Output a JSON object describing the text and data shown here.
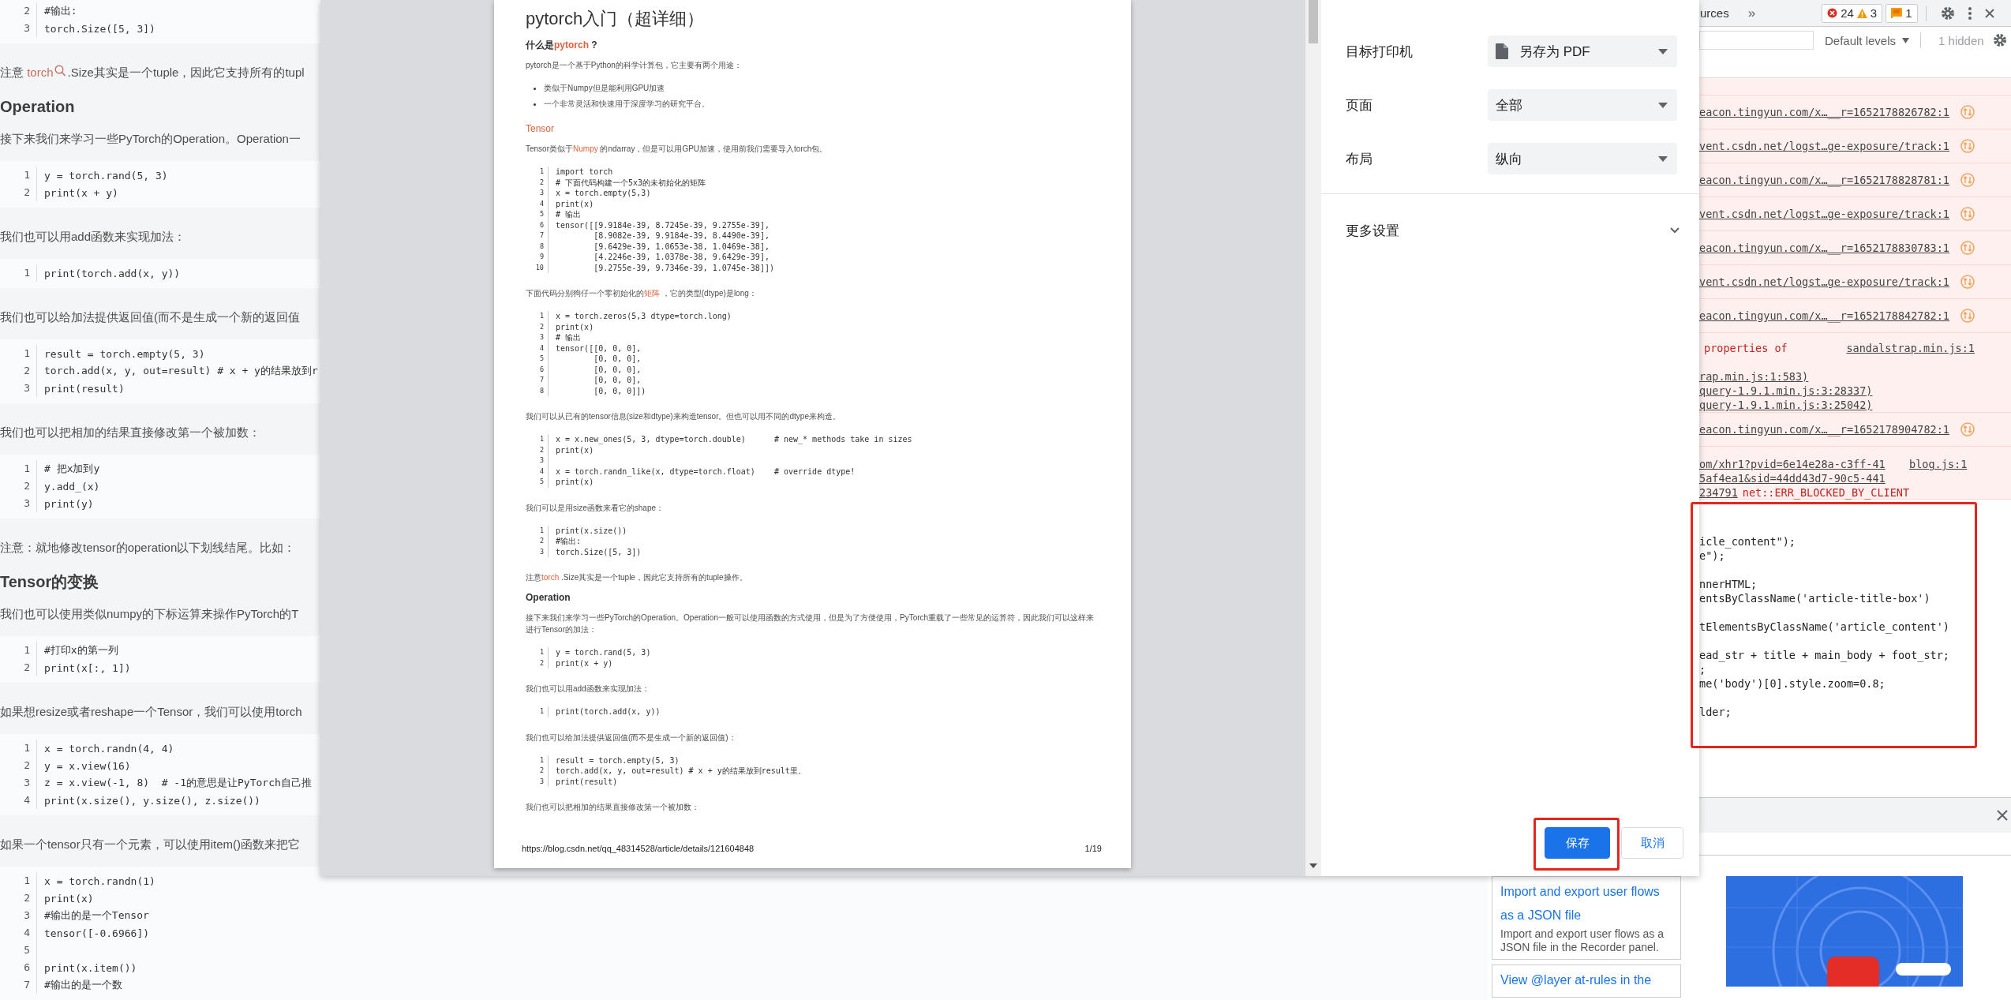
{
  "article": {
    "blocks": [
      {
        "kind": "code",
        "lines": [
          [
            "2",
            "#输出:"
          ],
          [
            "3",
            "torch.Size([5, 3])"
          ]
        ]
      },
      {
        "kind": "paragraph",
        "parts": [
          {
            "text": "注意 "
          },
          {
            "text": "torch",
            "kind": "search_link"
          },
          {
            "text": ".Size其实是一个tuple，因此它支持所有的tupl"
          }
        ]
      },
      {
        "kind": "heading",
        "parts": [
          {
            "text": "Operation"
          }
        ]
      },
      {
        "kind": "paragraph",
        "parts": [
          {
            "text": "接下来我们来学习一些PyTorch的Operation。Operation一"
          }
        ]
      },
      {
        "kind": "code",
        "lines": [
          [
            "1",
            "y = torch.rand(5, 3)"
          ],
          [
            "2",
            "print(x + y)"
          ]
        ]
      },
      {
        "kind": "paragraph",
        "parts": [
          {
            "text": "我们也可以用add函数来实现加法："
          }
        ]
      },
      {
        "kind": "code",
        "lines": [
          [
            "1",
            "print(torch.add(x, y))"
          ]
        ]
      },
      {
        "kind": "paragraph",
        "parts": [
          {
            "text": "我们也可以给加法提供返回值(而不是生成一个新的返回值"
          }
        ]
      },
      {
        "kind": "code",
        "lines": [
          [
            "1",
            "result = torch.empty(5, 3)"
          ],
          [
            "2",
            "torch.add(x, y, out=result) # x + y的结果放到r"
          ],
          [
            "3",
            "print(result)"
          ]
        ]
      },
      {
        "kind": "paragraph",
        "parts": [
          {
            "text": "我们也可以把相加的结果直接修改第一个被加数："
          }
        ]
      },
      {
        "kind": "code",
        "lines": [
          [
            "1",
            "# 把x加到y"
          ],
          [
            "2",
            "y.add_(x)"
          ],
          [
            "3",
            "print(y)"
          ]
        ]
      },
      {
        "kind": "paragraph",
        "parts": [
          {
            "text": "注意：就地修改tensor的operation以下划线结尾。比如："
          }
        ]
      },
      {
        "kind": "heading",
        "parts": [
          {
            "text": "Tensor的变换"
          }
        ]
      },
      {
        "kind": "paragraph",
        "parts": [
          {
            "text": "我们也可以使用类似numpy的下标运算来操作PyTorch的T"
          }
        ]
      },
      {
        "kind": "code",
        "lines": [
          [
            "1",
            "#打印x的第一列"
          ],
          [
            "2",
            "print(x[:, 1])"
          ]
        ]
      },
      {
        "kind": "paragraph",
        "parts": [
          {
            "text": "如果想resize或者reshape一个Tensor，我们可以使用torch"
          }
        ]
      },
      {
        "kind": "code",
        "lines": [
          [
            "1",
            "x = torch.randn(4, 4)"
          ],
          [
            "2",
            "y = x.view(16)"
          ],
          [
            "3",
            "z = x.view(-1, 8)  # -1的意思是让PyTorch自己推"
          ],
          [
            "4",
            "print(x.size(), y.size(), z.size())"
          ]
        ]
      },
      {
        "kind": "paragraph",
        "parts": [
          {
            "text": "如果一个tensor只有一个元素，可以使用item()函数来把它"
          }
        ]
      },
      {
        "kind": "code",
        "lines": [
          [
            "1",
            "x = torch.randn(1)"
          ],
          [
            "2",
            "print(x)"
          ],
          [
            "3",
            "#输出的是一个Tensor"
          ],
          [
            "4",
            "tensor([-0.6966])"
          ],
          [
            "5"
          ],
          [
            "6",
            "print(x.item())"
          ],
          [
            "7",
            "#输出的是一个数"
          ]
        ]
      }
    ]
  },
  "print_preview": {
    "blocks": [
      {
        "kind": "title",
        "parts": [
          {
            "text": "pytorch入门（超详细）"
          }
        ]
      },
      {
        "kind": "heading",
        "parts": [
          {
            "text": "什么是"
          },
          {
            "text": "pytorch",
            "kind": "link"
          },
          {
            "text": "  ?"
          }
        ]
      },
      {
        "kind": "paragraph",
        "parts": [
          {
            "text": "pytorch是一个基于Python的科学计算包，它主要有两个用途："
          }
        ]
      },
      {
        "kind": "list",
        "items": [
          "类似于Numpy但是能利用GPU加速",
          "一个非常灵活和快速用于深度学习的研究平台。"
        ]
      },
      {
        "kind": "section",
        "parts": [
          {
            "text": "Tensor",
            "kind": "link"
          }
        ]
      },
      {
        "kind": "paragraph",
        "parts": [
          {
            "text": "Tensor类似于"
          },
          {
            "text": "Numpy",
            "kind": "link"
          },
          {
            "text": "   的ndarray，但是可以用GPU加速，使用前我们需要导入torch包。"
          }
        ]
      },
      {
        "kind": "code",
        "lines": [
          [
            "1",
            "import torch"
          ],
          [
            "2",
            "# 下面代码构建一个5x3的未初始化的矩阵"
          ],
          [
            "3",
            "x = torch.empty(5,3)"
          ],
          [
            "4",
            "print(x)"
          ],
          [
            "5",
            "# 输出"
          ],
          [
            "6",
            "tensor([[9.9184e-39, 8.7245e-39, 9.2755e-39],"
          ],
          [
            "7",
            "        [8.9082e-39, 9.9184e-39, 8.4490e-39],"
          ],
          [
            "8",
            "        [9.6429e-39, 1.0653e-38, 1.0469e-38],"
          ],
          [
            "9",
            "        [4.2246e-39, 1.0378e-38, 9.6429e-39],"
          ],
          [
            "10",
            "        [9.2755e-39, 9.7346e-39, 1.0745e-38]])"
          ]
        ]
      },
      {
        "kind": "paragraph",
        "parts": [
          {
            "text": "下面代码分别狗仔一个零初始化的"
          },
          {
            "text": "矩阵",
            "kind": "link"
          },
          {
            "text": "   ，它的类型(dtype)是long："
          }
        ]
      },
      {
        "kind": "code",
        "lines": [
          [
            "1",
            "x = torch.zeros(5,3 dtype=torch.long)"
          ],
          [
            "2",
            "print(x)"
          ],
          [
            "3",
            "# 输出"
          ],
          [
            "4",
            "tensor([[0, 0, 0],"
          ],
          [
            "5",
            "        [0, 0, 0],"
          ],
          [
            "6",
            "        [0, 0, 0],"
          ],
          [
            "7",
            "        [0, 0, 0],"
          ],
          [
            "8",
            "        [0, 0, 0]])"
          ]
        ]
      },
      {
        "kind": "paragraph",
        "parts": [
          {
            "text": "我们可以从已有的tensor信息(size和dtype)来构造tensor。但也可以用不同的dtype来构造。"
          }
        ]
      },
      {
        "kind": "code",
        "lines": [
          [
            "1",
            "x = x.new_ones(5, 3, dtype=torch.double)      # new_* methods take in sizes"
          ],
          [
            "2",
            "print(x)"
          ],
          [
            "3"
          ],
          [
            "4",
            "x = torch.randn_like(x, dtype=torch.float)    # override dtype!"
          ],
          [
            "5",
            "print(x)"
          ]
        ]
      },
      {
        "kind": "paragraph",
        "parts": [
          {
            "text": "我们可以是用size函数来看它的shape："
          }
        ]
      },
      {
        "kind": "code",
        "lines": [
          [
            "1",
            "print(x.size())"
          ],
          [
            "2",
            "#输出:"
          ],
          [
            "3",
            "torch.Size([5, 3])"
          ]
        ]
      },
      {
        "kind": "paragraph",
        "parts": [
          {
            "text": "注意"
          },
          {
            "text": "torch",
            "kind": "link"
          },
          {
            "text": "    .Size其实是一个tuple，因此它支持所有的tuple操作。"
          }
        ]
      },
      {
        "kind": "heading",
        "parts": [
          {
            "text": "Operation"
          }
        ]
      },
      {
        "kind": "paragraph",
        "parts": [
          {
            "text": "接下来我们来学习一些PyTorch的Operation。Operation一般可以使用函数的方式使用，但是为了方便使用，PyTorch重载了一些常见的运算符，因此我们可以这样来进行Tensor的加法："
          }
        ]
      },
      {
        "kind": "code",
        "lines": [
          [
            "1",
            "y = torch.rand(5, 3)"
          ],
          [
            "2",
            "print(x + y)"
          ]
        ]
      },
      {
        "kind": "paragraph",
        "parts": [
          {
            "text": "我们也可以用add函数来实现加法："
          }
        ]
      },
      {
        "kind": "code",
        "lines": [
          [
            "1",
            "print(torch.add(x, y))"
          ]
        ]
      },
      {
        "kind": "paragraph",
        "parts": [
          {
            "text": "我们也可以给加法提供返回值(而不是生成一个新的返回值)："
          }
        ]
      },
      {
        "kind": "code",
        "lines": [
          [
            "1",
            "result = torch.empty(5, 3)"
          ],
          [
            "2",
            "torch.add(x, y, out=result) # x + y的结果放到result里。"
          ],
          [
            "3",
            "print(result)"
          ]
        ]
      },
      {
        "kind": "paragraph",
        "parts": [
          {
            "text": "我们也可以把相加的结果直接修改第一个被加数："
          }
        ]
      }
    ],
    "footer_url": "https://blog.csdn.net/qq_48314528/article/details/121604848",
    "page_number": "1/19"
  },
  "print_settings": {
    "fields": [
      {
        "label": "目标打印机",
        "value": "另存为 PDF",
        "kind": "destination"
      },
      {
        "label": "页面",
        "value": "全部",
        "kind": "select"
      },
      {
        "label": "布局",
        "value": "纵向",
        "kind": "select"
      }
    ],
    "more": {
      "label": "更多设置",
      "expanded": false
    },
    "buttons": [
      {
        "label": "保存",
        "primary": true,
        "highlighted": true
      },
      {
        "label": "取消",
        "primary": false,
        "highlighted": false
      }
    ]
  },
  "devtools": {
    "tab_label": "urces",
    "more_tabs": "»",
    "counts": {
      "errors": "24",
      "warnings": "3",
      "issues": "1"
    },
    "levels": "Default levels",
    "hidden": "1 hidden",
    "messages": [
      {
        "kind": "request",
        "url": "eacon.tingyun.com/x…__r=1652178826782:1"
      },
      {
        "kind": "request",
        "url": "vent.csdn.net/logst…ge-exposure/track:1"
      },
      {
        "kind": "request",
        "url": "eacon.tingyun.com/x…__r=1652178828781:1"
      },
      {
        "kind": "request",
        "url": "vent.csdn.net/logst…ge-exposure/track:1"
      },
      {
        "kind": "request",
        "url": "eacon.tingyun.com/x…__r=1652178830783:1"
      },
      {
        "kind": "request",
        "url": "vent.csdn.net/logst…ge-exposure/track:1"
      },
      {
        "kind": "request",
        "url": "eacon.tingyun.com/x…__r=1652178842782:1"
      },
      {
        "kind": "error",
        "text": "properties of",
        "source": "sandalstrap.min.js:1",
        "stack": [
          "rap.min.js:1:583)",
          "query-1.9.1.min.js:3:28337)",
          "query-1.9.1.min.js:3:25042)"
        ]
      },
      {
        "kind": "request",
        "url": "eacon.tingyun.com/x…__r=1652178904782:1"
      },
      {
        "kind": "blocked",
        "url_lines": [
          "om/xhr1?pvid=6e14e28a-c3ff-41",
          "5af4ea1&sid=44dd43d7-90c5-441",
          "234791"
        ],
        "error": "net::ERR_BLOCKED_BY_CLIENT",
        "source": "blog.js:1"
      }
    ],
    "code_highlighted": true,
    "code_groups": [
      [
        "icle_content\");",
        "e\");"
      ],
      [
        "nnerHTML;",
        "entsByClassName('article-title-box')"
      ],
      [
        "tElementsByClassName('article_content')"
      ],
      [
        "ead_str + title + main_body + foot_str;",
        ";",
        "me('body')[0].style.zoom=0.8;"
      ],
      [
        "lder;"
      ]
    ],
    "drawer": {
      "cards": [
        {
          "title": "Import and export user flows as a JSON file",
          "description": "Import and export user flows as a JSON file in the Recorder panel."
        },
        {
          "title": "View @layer at-rules in the"
        }
      ]
    }
  }
}
